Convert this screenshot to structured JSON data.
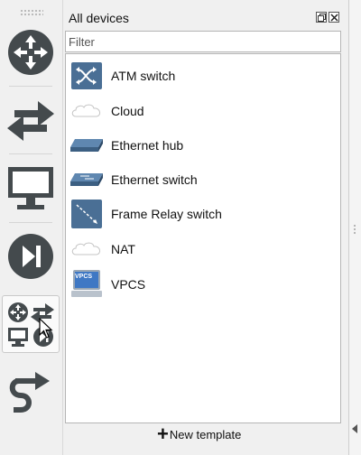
{
  "panel": {
    "title": "All devices",
    "filter_placeholder": "Filter",
    "new_template_label": "New template",
    "devices": [
      {
        "label": "ATM switch",
        "icon": "atm-switch-icon"
      },
      {
        "label": "Cloud",
        "icon": "cloud-icon"
      },
      {
        "label": "Ethernet hub",
        "icon": "ethernet-hub-icon"
      },
      {
        "label": "Ethernet switch",
        "icon": "ethernet-switch-icon"
      },
      {
        "label": "Frame Relay switch",
        "icon": "frame-relay-switch-icon"
      },
      {
        "label": "NAT",
        "icon": "nat-icon"
      },
      {
        "label": "VPCS",
        "icon": "vpcs-icon"
      }
    ],
    "vpcs_icon_text": "VPCS"
  },
  "toolbar": {
    "buttons": [
      "routers-icon",
      "switches-icon",
      "end-devices-icon",
      "security-devices-icon",
      "all-devices-icon",
      "add-link-icon"
    ],
    "active": "all-devices-icon"
  },
  "colors": {
    "toolbar_icon": "#444a4d",
    "device_blue": "#4a6f95",
    "panel_bg": "#f0f0f0"
  }
}
